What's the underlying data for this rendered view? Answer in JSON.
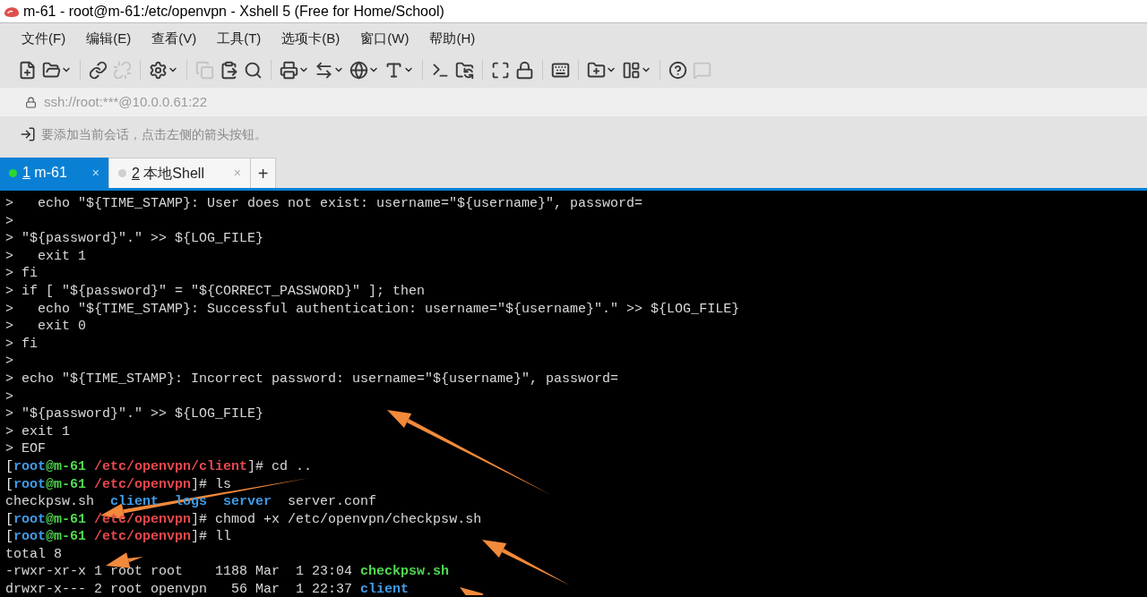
{
  "window": {
    "title": "m-61 - root@m-61:/etc/openvpn - Xshell 5 (Free for Home/School)"
  },
  "menu": [
    "文件(F)",
    "编辑(E)",
    "查看(V)",
    "工具(T)",
    "选项卡(B)",
    "窗口(W)",
    "帮助(H)"
  ],
  "toolbar": [
    {
      "kind": "new",
      "disabled": false,
      "dropdown": false
    },
    {
      "kind": "open",
      "disabled": false,
      "dropdown": true
    },
    {
      "kind": "sep"
    },
    {
      "kind": "connect",
      "disabled": false,
      "dropdown": false
    },
    {
      "kind": "disconnect",
      "disabled": true,
      "dropdown": false
    },
    {
      "kind": "sep"
    },
    {
      "kind": "properties",
      "disabled": false,
      "dropdown": true
    },
    {
      "kind": "sep"
    },
    {
      "kind": "copy",
      "disabled": true,
      "dropdown": false
    },
    {
      "kind": "paste",
      "disabled": false,
      "dropdown": false
    },
    {
      "kind": "find",
      "disabled": false,
      "dropdown": false
    },
    {
      "kind": "sep"
    },
    {
      "kind": "print",
      "disabled": false,
      "dropdown": true
    },
    {
      "kind": "transfer",
      "disabled": false,
      "dropdown": true
    },
    {
      "kind": "globe",
      "disabled": false,
      "dropdown": true
    },
    {
      "kind": "font",
      "disabled": false,
      "dropdown": true
    },
    {
      "kind": "sep"
    },
    {
      "kind": "shell",
      "disabled": false,
      "dropdown": false
    },
    {
      "kind": "ftp",
      "disabled": false,
      "dropdown": false
    },
    {
      "kind": "sep"
    },
    {
      "kind": "fullscreen",
      "disabled": false,
      "dropdown": false
    },
    {
      "kind": "lock",
      "disabled": false,
      "dropdown": false
    },
    {
      "kind": "sep"
    },
    {
      "kind": "keyboard",
      "disabled": false,
      "dropdown": false
    },
    {
      "kind": "sep"
    },
    {
      "kind": "add-folder",
      "disabled": false,
      "dropdown": true
    },
    {
      "kind": "layout",
      "disabled": false,
      "dropdown": true
    },
    {
      "kind": "sep"
    },
    {
      "kind": "help",
      "disabled": false,
      "dropdown": false
    },
    {
      "kind": "chat",
      "disabled": true,
      "dropdown": false
    }
  ],
  "address": {
    "value": "ssh://root:***@10.0.0.61:22"
  },
  "hint": "要添加当前会话，点击左侧的箭头按钮。",
  "tabs": [
    {
      "number": "1",
      "label": " m-61",
      "close": "×",
      "selected": true,
      "connected": true
    },
    {
      "number": "2",
      "label": " 本地Shell",
      "close": "×",
      "selected": false,
      "connected": false
    }
  ],
  "new_tab": "+",
  "terminal": [
    [
      {
        "kind": "plain",
        "text": ">   echo \"${TIME_STAMP}: User does not exist: username=\"${username}\", password="
      }
    ],
    [
      {
        "kind": "plain",
        "text": ">"
      }
    ],
    [
      {
        "kind": "plain",
        "text": "> \"${password}\".\" >> ${LOG_FILE}"
      }
    ],
    [
      {
        "kind": "plain",
        "text": ">   exit 1"
      }
    ],
    [
      {
        "kind": "plain",
        "text": "> fi"
      }
    ],
    [
      {
        "kind": "plain",
        "text": "> if [ \"${password}\" = \"${CORRECT_PASSWORD}\" ]; then"
      }
    ],
    [
      {
        "kind": "plain",
        "text": ">   echo \"${TIME_STAMP}: Successful authentication: username=\"${username}\".\" >> ${LOG_FILE}"
      }
    ],
    [
      {
        "kind": "plain",
        "text": ">   exit 0"
      }
    ],
    [
      {
        "kind": "plain",
        "text": "> fi"
      }
    ],
    [
      {
        "kind": "plain",
        "text": ">"
      }
    ],
    [
      {
        "kind": "plain",
        "text": "> echo \"${TIME_STAMP}: Incorrect password: username=\"${username}\", password="
      }
    ],
    [
      {
        "kind": "plain",
        "text": ">"
      }
    ],
    [
      {
        "kind": "plain",
        "text": "> \"${password}\".\" >> ${LOG_FILE}"
      }
    ],
    [
      {
        "kind": "plain",
        "text": "> exit 1"
      }
    ],
    [
      {
        "kind": "plain",
        "text": "> EOF"
      }
    ],
    [
      {
        "kind": "bracket",
        "text": "["
      },
      {
        "kind": "user",
        "text": "root"
      },
      {
        "kind": "host",
        "text": "@m-61 "
      },
      {
        "kind": "path",
        "text": "/etc/openvpn/client"
      },
      {
        "kind": "plain",
        "text": "]# cd .."
      }
    ],
    [
      {
        "kind": "bracket",
        "text": "["
      },
      {
        "kind": "user",
        "text": "root"
      },
      {
        "kind": "host",
        "text": "@m-61 "
      },
      {
        "kind": "path",
        "text": "/etc/openvpn"
      },
      {
        "kind": "plain",
        "text": "]# ls"
      }
    ],
    [
      {
        "kind": "plain",
        "text": "checkpsw.sh  "
      },
      {
        "kind": "dir",
        "text": "client  "
      },
      {
        "kind": "dir",
        "text": "logs  "
      },
      {
        "kind": "dir",
        "text": "server"
      },
      {
        "kind": "plain",
        "text": "  server.conf"
      }
    ],
    [
      {
        "kind": "bracket",
        "text": "["
      },
      {
        "kind": "user",
        "text": "root"
      },
      {
        "kind": "host",
        "text": "@m-61 "
      },
      {
        "kind": "path",
        "text": "/etc/openvpn"
      },
      {
        "kind": "plain",
        "text": "]# chmod +x /etc/openvpn/checkpsw.sh"
      }
    ],
    [
      {
        "kind": "bracket",
        "text": "["
      },
      {
        "kind": "user",
        "text": "root"
      },
      {
        "kind": "host",
        "text": "@m-61 "
      },
      {
        "kind": "path",
        "text": "/etc/openvpn"
      },
      {
        "kind": "plain",
        "text": "]# ll"
      }
    ],
    [
      {
        "kind": "plain",
        "text": "total 8"
      }
    ],
    [
      {
        "kind": "plain",
        "text": "-rwxr-xr-x 1 root root    1188 Mar  1 23:04 "
      },
      {
        "kind": "exec",
        "text": "checkpsw.sh"
      }
    ],
    [
      {
        "kind": "plain",
        "text": "drwxr-x--- 2 root openvpn   56 Mar  1 22:37 "
      },
      {
        "kind": "dir",
        "text": "client"
      }
    ]
  ]
}
